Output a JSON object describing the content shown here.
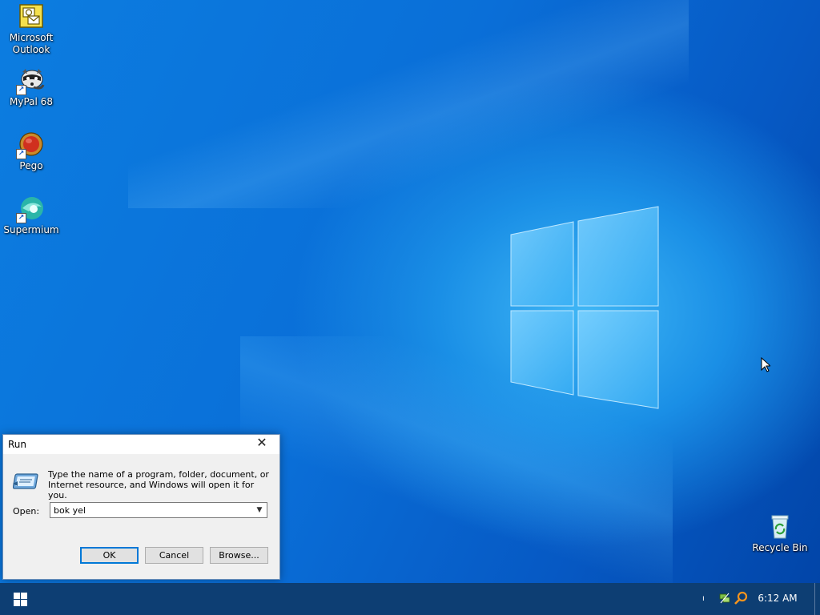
{
  "desktop": {
    "icons": [
      {
        "label": "Microsoft\nOutlook",
        "icon": "outlook-icon"
      },
      {
        "label": "MyPal 68",
        "icon": "mypal-raccoon-icon"
      },
      {
        "label": "Pego",
        "icon": "pego-icon"
      },
      {
        "label": "Supermium",
        "icon": "supermium-icon"
      },
      {
        "label": "Recycle Bin",
        "icon": "recycle-bin-icon"
      }
    ]
  },
  "run_dialog": {
    "title": "Run",
    "description": "Type the name of a program, folder, document, or Internet resource, and Windows will open it for you.",
    "open_label": "Open:",
    "input_value": "bok yel",
    "ok_label": "OK",
    "cancel_label": "Cancel",
    "browse_label": "Browse..."
  },
  "taskbar": {
    "clock": "6:12 AM",
    "tray_icons": [
      "network-icon",
      "search-icon"
    ]
  },
  "colors": {
    "desktop_blue": "#0a6fd8",
    "taskbar": "#0d3e73",
    "accent": "#0078d7"
  }
}
